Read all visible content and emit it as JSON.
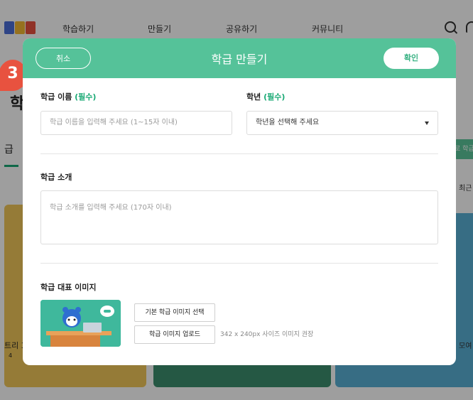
{
  "background": {
    "nav": [
      "학습하기",
      "만들기",
      "공유하기",
      "커뮤니티"
    ],
    "page_title": "학",
    "tab": "급",
    "right_text_1": "최근",
    "right_text_2": "모여",
    "left_text_1": "트리 3",
    "left_text_2": "4",
    "green_btn": "로 학급"
  },
  "badge": "3",
  "modal": {
    "title": "학급 만들기",
    "cancel_label": "취소",
    "confirm_label": "확인",
    "class_name": {
      "label": "학급 이름",
      "required": "(필수)",
      "placeholder": "학급 이름을 입력해 주세요 (1~15자 이내)"
    },
    "grade": {
      "label": "학년",
      "required": "(필수)",
      "value": "학년을 선택해 주세요"
    },
    "intro": {
      "label": "학급 소개",
      "placeholder": "학급 소개를 입력해 주세요 (170자 이내)"
    },
    "image": {
      "label": "학급 대표 이미지",
      "default_button": "기본 학급 이미지 선택",
      "upload_button": "학급 이미지 업로드",
      "hint": "342 x 240px 사이즈 이미지 권장"
    }
  },
  "colors": {
    "accent": "#55c299",
    "required": "#19a974",
    "badge": "#e8523f"
  }
}
